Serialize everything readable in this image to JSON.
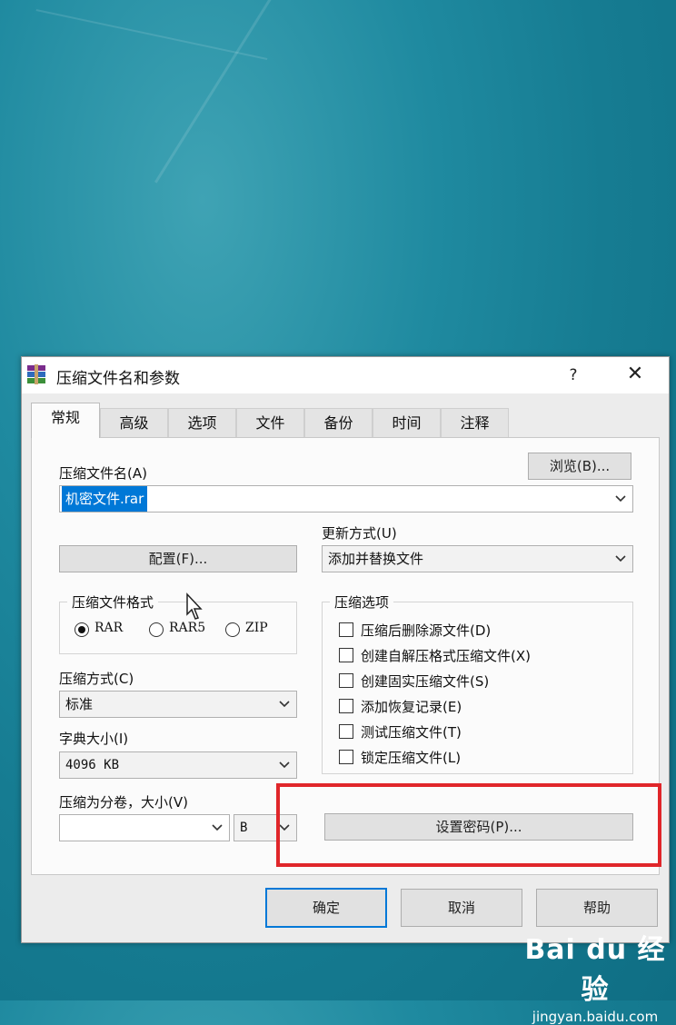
{
  "dialog": {
    "title": "压缩文件名和参数",
    "help": "?",
    "close": "✕"
  },
  "tabs": [
    "常规",
    "高级",
    "选项",
    "文件",
    "备份",
    "时间",
    "注释"
  ],
  "general": {
    "archive_name_label": "压缩文件名(A)",
    "browse_button": "浏览(B)...",
    "archive_name_value": "机密文件.rar",
    "update_mode_label": "更新方式(U)",
    "update_mode_value": "添加并替换文件",
    "profiles_button": "配置(F)...",
    "format_group_title": "压缩文件格式",
    "formats": [
      "RAR",
      "RAR5",
      "ZIP"
    ],
    "selected_format": "RAR",
    "options_group_title": "压缩选项",
    "options": [
      "压缩后删除源文件(D)",
      "创建自解压格式压缩文件(X)",
      "创建固实压缩文件(S)",
      "添加恢复记录(E)",
      "测试压缩文件(T)",
      "锁定压缩文件(L)"
    ],
    "method_label": "压缩方式(C)",
    "method_value": "标准",
    "dictionary_label": "字典大小(I)",
    "dictionary_value": "4096 KB",
    "volume_label": "压缩为分卷，大小(V)",
    "volume_value": "",
    "volume_unit": "B",
    "password_button": "设置密码(P)..."
  },
  "footer": {
    "ok": "确定",
    "cancel": "取消",
    "help": "帮助"
  },
  "watermark": {
    "logo": "Bai du 经验",
    "url": "jingyan.baidu.com"
  },
  "colors": {
    "highlight_border": "#e0262a",
    "selection_bg": "#0078d7"
  }
}
